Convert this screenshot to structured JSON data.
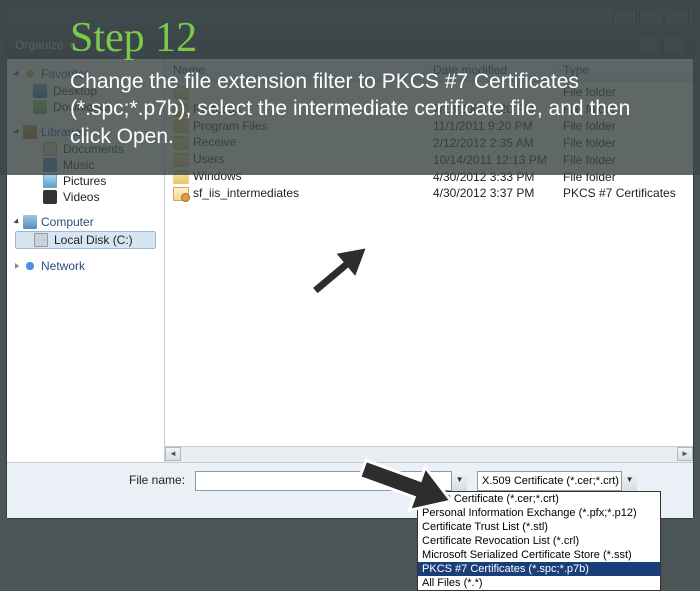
{
  "overlay": {
    "title": "Step 12",
    "body": "Change the file extension filter to PKCS #7 Certificates (*.spc;*.p7b), select the intermediate certificate file, and then click Open."
  },
  "toolbar": {
    "organize": "Organize"
  },
  "nav": {
    "favorites": "Favorites",
    "desktop": "Desktop",
    "downloads": "Downloads",
    "libraries": "Libraries",
    "documents": "Documents",
    "music": "Music",
    "pictures": "Pictures",
    "videos": "Videos",
    "computer": "Computer",
    "localdisk": "Local Disk (C:)",
    "network": "Network"
  },
  "columns": {
    "name": "Name",
    "date": "Date modified",
    "type": "Type"
  },
  "rows": [
    {
      "name": "",
      "date": "",
      "type": "File folder",
      "icon": "folder",
      "hidden_left": true
    },
    {
      "name": "PerfLogs",
      "date": "7/13/2009 8:20 PM",
      "type": "File folder",
      "icon": "folder",
      "partial": true
    },
    {
      "name": "Program Files",
      "date": "11/1/2011 9:20 PM",
      "type": "File folder",
      "icon": "folder",
      "partial": true
    },
    {
      "name": "Receive",
      "date": "2/12/2012 2:35 AM",
      "type": "File folder",
      "icon": "folder",
      "partial": true
    },
    {
      "name": "Users",
      "date": "10/14/2011 12:13 PM",
      "type": "File folder",
      "icon": "folder"
    },
    {
      "name": "Windows",
      "date": "4/30/2012 3:33 PM",
      "type": "File folder",
      "icon": "folder"
    },
    {
      "name": "sf_iis_intermediates",
      "date": "4/30/2012 3:37 PM",
      "type": "PKCS #7 Certificates",
      "icon": "cert"
    }
  ],
  "file_open": {
    "label": "File name:",
    "value": "",
    "selected_filter": "X.509 Certificate (*.cer;*.crt)",
    "filters": [
      "X.509 Certificate (*.cer;*.crt)",
      "Personal Information Exchange (*.pfx;*.p12)",
      "Certificate Trust List (*.stl)",
      "Certificate Revocation List (*.crl)",
      "Microsoft Serialized Certificate Store (*.sst)",
      "PKCS #7 Certificates (*.spc;*.p7b)",
      "All Files (*.*)"
    ],
    "highlight_index": 5
  }
}
